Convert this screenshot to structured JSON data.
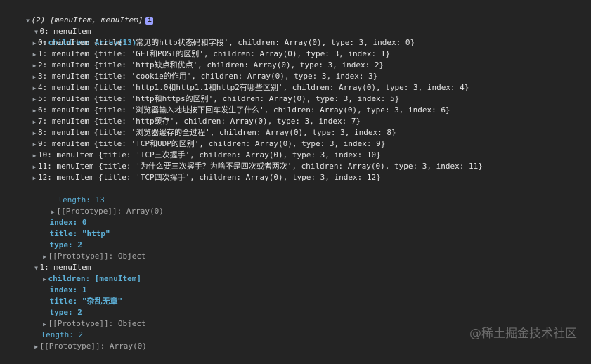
{
  "root": {
    "summary": "(2) [menuItem, menuItem]",
    "info": "i"
  },
  "item0": {
    "header": "0: menuItem",
    "children_header": "children: Array(13)",
    "children": [
      "0: menuItem {title: '常见的http状态码和字段', children: Array(0), type: 3, index: 0}",
      "1: menuItem {title: 'GET和POST的区别', children: Array(0), type: 3, index: 1}",
      "2: menuItem {title: 'http缺点和优点', children: Array(0), type: 3, index: 2}",
      "3: menuItem {title: 'cookie的作用', children: Array(0), type: 3, index: 3}",
      "4: menuItem {title: 'http1.0和http1.1和http2有哪些区别', children: Array(0), type: 3, index: 4}",
      "5: menuItem {title: 'http和https的区别', children: Array(0), type: 3, index: 5}",
      "6: menuItem {title: '浏览器输入地址按下回车发生了什么', children: Array(0), type: 3, index: 6}",
      "7: menuItem {title: 'http缓存', children: Array(0), type: 3, index: 7}",
      "8: menuItem {title: '浏览器缓存的全过程', children: Array(0), type: 3, index: 8}",
      "9: menuItem {title: 'TCP和UDP的区别', children: Array(0), type: 3, index: 9}",
      "10: menuItem {title: 'TCP三次握手', children: Array(0), type: 3, index: 10}",
      "11: menuItem {title: '为什么要三次握手？为啥不是四次或者两次', children: Array(0), type: 3, index: 11}",
      "12: menuItem {title: 'TCP四次挥手', children: Array(0), type: 3, index: 12}"
    ],
    "children_length": "length: 13",
    "children_proto": "[[Prototype]]: Array(0)",
    "index": "index: 0",
    "title": "title: \"http\"",
    "type": "type: 2",
    "proto": "[[Prototype]]: Object"
  },
  "item1": {
    "header": "1: menuItem",
    "children": "children: [menuItem]",
    "index": "index: 1",
    "title": "title: \"杂乱无章\"",
    "type": "type: 2",
    "proto": "[[Prototype]]: Object"
  },
  "root_length": "length: 2",
  "root_proto": "[[Prototype]]: Array(0)",
  "watermark": "@稀土掘金技术社区"
}
